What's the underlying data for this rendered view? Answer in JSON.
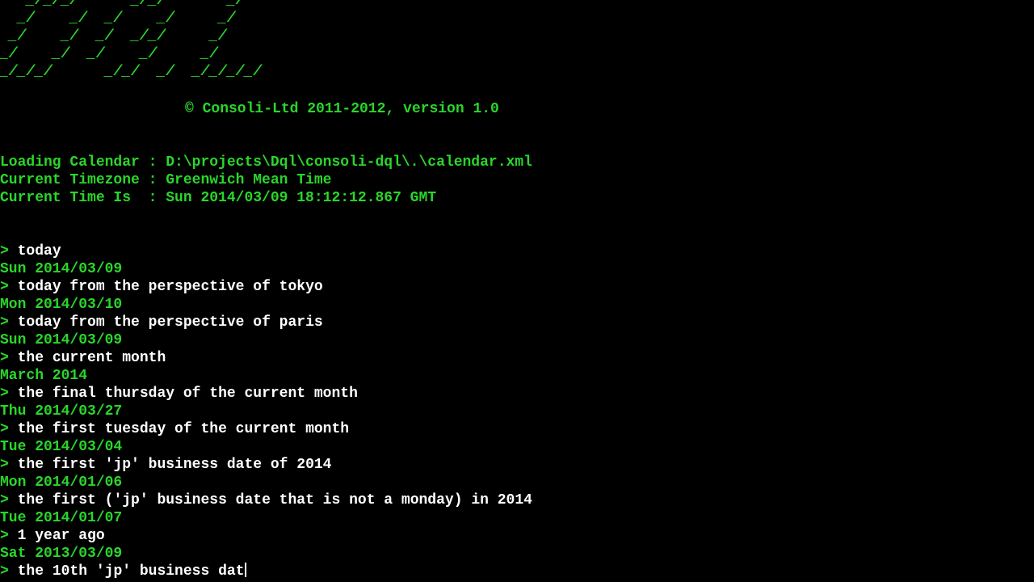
{
  "banner": {
    "ascii_art": "   _/_/_/      _/_/       _/\n  _/    _/  _/    _/     _/\n _/    _/  _/  _/_/     _/\n_/    _/  _/    _/     _/\n_/_/_/      _/_/  _/  _/_/_/_/"
  },
  "copyright": "© Consoli-Ltd 2011-2012, version 1.0",
  "status": {
    "loading": "Loading Calendar : D:\\projects\\Dql\\consoli-dql\\.\\calendar.xml",
    "timezone": "Current Timezone : Greenwich Mean Time",
    "time": "Current Time Is  : Sun 2014/03/09 18:12:12.867 GMT"
  },
  "prompt_symbol": ">",
  "session": [
    {
      "command": "today",
      "output": "Sun 2014/03/09"
    },
    {
      "command": "today from the perspective of tokyo",
      "output": "Mon 2014/03/10"
    },
    {
      "command": "today from the perspective of paris",
      "output": "Sun 2014/03/09"
    },
    {
      "command": "the current month",
      "output": "March 2014"
    },
    {
      "command": "the final thursday of the current month",
      "output": "Thu 2014/03/27"
    },
    {
      "command": "the first tuesday of the current month",
      "output": "Tue 2014/03/04"
    },
    {
      "command": "the first 'jp' business date of 2014",
      "output": "Mon 2014/01/06"
    },
    {
      "command": "the first ('jp' business date that is not a monday) in 2014",
      "output": "Tue 2014/01/07"
    },
    {
      "command": "1 year ago",
      "output": "Sat 2013/03/09"
    }
  ],
  "current_input": "the 10th 'jp' business dat",
  "colors": {
    "background": "#000000",
    "output_green": "#2ad62a",
    "command_white": "#ffffff"
  }
}
